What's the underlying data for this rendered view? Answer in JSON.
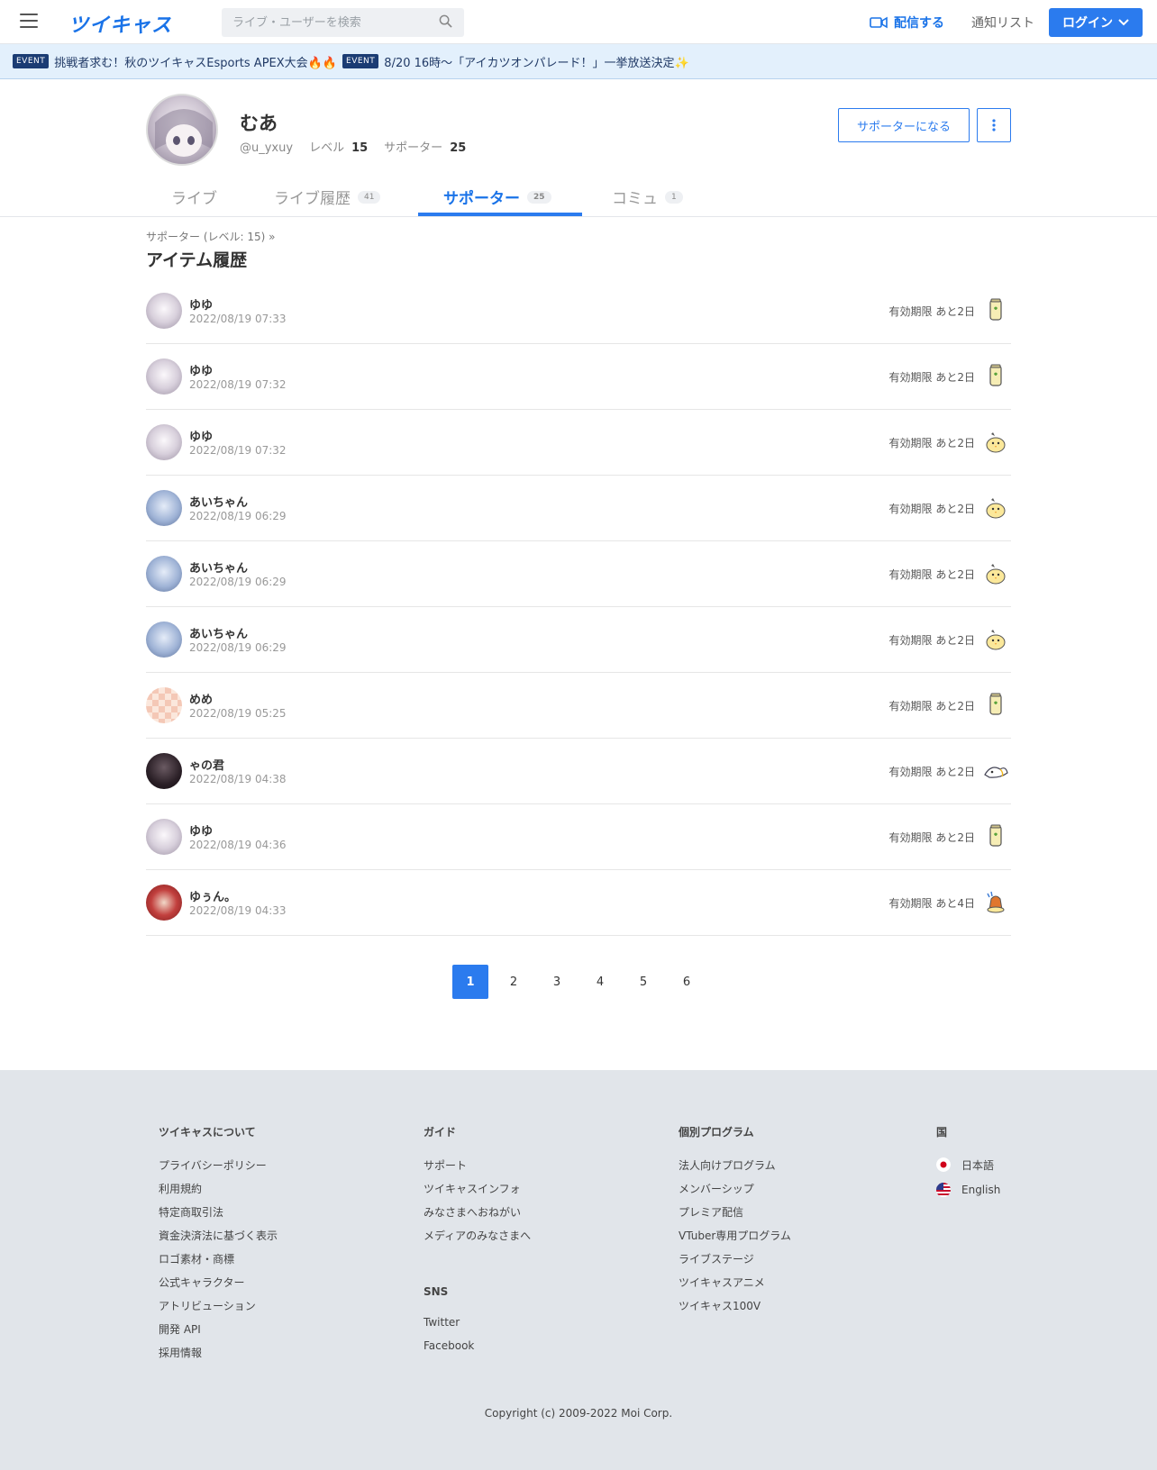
{
  "header": {
    "logo": "ツイキャス",
    "search_placeholder": "ライブ・ユーザーを検索",
    "broadcast_label": "配信する",
    "notify_label": "通知リスト",
    "login_label": "ログイン"
  },
  "events": [
    {
      "badge": "EVENT",
      "text": "挑戦者求む！秋のツイキャスEsports APEX大会🔥🔥"
    },
    {
      "badge": "EVENT",
      "text": "8/20 16時〜「アイカツオンパレード！」一挙放送決定✨"
    }
  ],
  "profile": {
    "name": "むあ",
    "handle": "@u_yxuy",
    "level_label": "レベル",
    "level": "15",
    "supporter_label": "サポーター",
    "supporter_count": "25",
    "become_supporter": "サポーターになる"
  },
  "tabs": [
    {
      "label": "ライブ",
      "count": ""
    },
    {
      "label": "ライブ履歴",
      "count": "41"
    },
    {
      "label": "サポーター",
      "count": "25"
    },
    {
      "label": "コミュ",
      "count": "1"
    }
  ],
  "breadcrumb": "サポーター (レベル: 15)  »",
  "section_title": "アイテム履歴",
  "items": [
    {
      "name": "ゆゆ",
      "date": "2022/08/19 07:33",
      "expiry": "有効期限 あと2日",
      "avatar": "yuyu",
      "icon": "tea-can-icon"
    },
    {
      "name": "ゆゆ",
      "date": "2022/08/19 07:32",
      "expiry": "有効期限 あと2日",
      "avatar": "yuyu",
      "icon": "tea-can-icon"
    },
    {
      "name": "ゆゆ",
      "date": "2022/08/19 07:32",
      "expiry": "有効期限 あと2日",
      "avatar": "yuyu",
      "icon": "chick-icon"
    },
    {
      "name": "あいちゃん",
      "date": "2022/08/19 06:29",
      "expiry": "有効期限 あと2日",
      "avatar": "ai",
      "icon": "chick-icon"
    },
    {
      "name": "あいちゃん",
      "date": "2022/08/19 06:29",
      "expiry": "有効期限 あと2日",
      "avatar": "ai",
      "icon": "chick-icon"
    },
    {
      "name": "あいちゃん",
      "date": "2022/08/19 06:29",
      "expiry": "有効期限 あと2日",
      "avatar": "ai",
      "icon": "chick-icon"
    },
    {
      "name": "めめ",
      "date": "2022/08/19 05:25",
      "expiry": "有効期限 あと2日",
      "avatar": "meme",
      "icon": "tea-can-icon"
    },
    {
      "name": "ゃの君",
      "date": "2022/08/19 04:38",
      "expiry": "有効期限 あと2日",
      "avatar": "ya",
      "icon": "bird-icon"
    },
    {
      "name": "ゆゆ",
      "date": "2022/08/19 04:36",
      "expiry": "有効期限 あと2日",
      "avatar": "yuyu",
      "icon": "tea-can-icon"
    },
    {
      "name": "ゆぅん。",
      "date": "2022/08/19 04:33",
      "expiry": "有効期限 あと4日",
      "avatar": "yun",
      "icon": "bell-chick-icon"
    }
  ],
  "pagination": [
    "1",
    "2",
    "3",
    "4",
    "5",
    "6"
  ],
  "footer": {
    "col1_title": "ツイキャスについて",
    "col1_links": [
      "プライバシーポリシー",
      "利用規約",
      "特定商取引法",
      "資金決済法に基づく表示",
      "ロゴ素材・商標",
      "公式キャラクター",
      "アトリビューション",
      "開発 API",
      "採用情報"
    ],
    "col2_title": "ガイド",
    "col2_links": [
      "サポート",
      "ツイキャスインフォ",
      "みなさまへおねがい",
      "メディアのみなさまへ"
    ],
    "sns_title": "SNS",
    "sns_links": [
      "Twitter",
      "Facebook"
    ],
    "col3_title": "個別プログラム",
    "col3_links": [
      "法人向けプログラム",
      "メンバーシップ",
      "プレミア配信",
      "VTuber専用プログラム",
      "ライブステージ",
      "ツイキャスアニメ",
      "ツイキャス100V"
    ],
    "col4_title": "国",
    "languages": [
      "日本語",
      "English"
    ],
    "copyright": "Copyright (c) 2009-2022 Moi Corp."
  },
  "colors": {
    "accent": "#2b7bee",
    "event_badge": "#1b3c73",
    "event_bg": "#e3f0fc",
    "footer_bg": "#e1e5ea"
  }
}
